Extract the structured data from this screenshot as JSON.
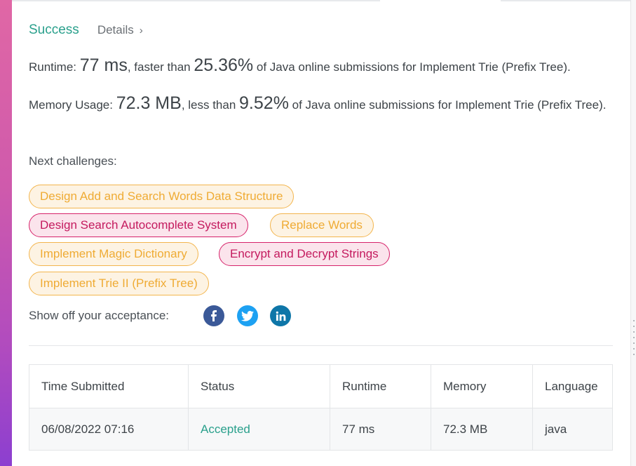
{
  "result": {
    "status": "Success",
    "details_label": "Details",
    "details_chevron": "›"
  },
  "runtime": {
    "label": "Runtime: ",
    "value": "77 ms",
    "compare_text": ", faster than ",
    "percent": "25.36%",
    "suffix": " of Java online submissions for Implement Trie (Prefix Tree)."
  },
  "memory": {
    "label": "Memory Usage: ",
    "value": "72.3 MB",
    "compare_text": ", less than ",
    "percent": "9.52%",
    "suffix": " of Java online submissions for Implement Trie (Prefix Tree)."
  },
  "next_challenges": {
    "label": "Next challenges:",
    "items": [
      {
        "label": "Design Add and Search Words Data Structure",
        "difficulty": "medium"
      },
      {
        "label": "Design Search Autocomplete System",
        "difficulty": "hard"
      },
      {
        "label": "Replace Words",
        "difficulty": "medium"
      },
      {
        "label": "Implement Magic Dictionary",
        "difficulty": "medium"
      },
      {
        "label": "Encrypt and Decrypt Strings",
        "difficulty": "hard"
      },
      {
        "label": "Implement Trie II (Prefix Tree)",
        "difficulty": "medium"
      }
    ]
  },
  "share": {
    "label": "Show off your acceptance:",
    "icons": [
      "facebook-icon",
      "twitter-icon",
      "linkedin-icon"
    ]
  },
  "submissions": {
    "columns": [
      "Time Submitted",
      "Status",
      "Runtime",
      "Memory",
      "Language"
    ],
    "rows": [
      {
        "time": "06/08/2022 07:16",
        "status": "Accepted",
        "runtime": "77 ms",
        "memory": "72.3 MB",
        "language": "java"
      }
    ]
  },
  "colors": {
    "accent_green": "#2aa08c",
    "medium_orange": "#efab34",
    "hard_pink": "#c41a5e"
  }
}
